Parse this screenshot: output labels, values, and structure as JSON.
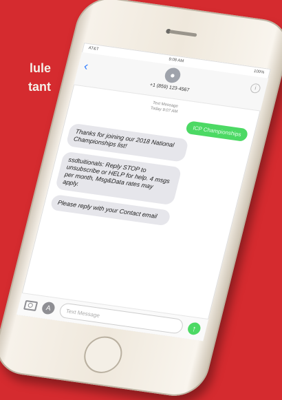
{
  "side_text": {
    "line1": "lule",
    "line2": "tant"
  },
  "status_bar": {
    "carrier": "AT&T",
    "time": "9:08 AM",
    "battery": "100%"
  },
  "conversation": {
    "contact_number": "+1 (859) 123-4567",
    "meta_line1": "Text Message",
    "meta_line2": "Today 9:07 AM",
    "outgoing_text": "ICP Championships",
    "incoming": [
      "Thanks for joining our 2018 National Championships list!",
      "ssdtuitionals: Reply STOP to unsubscribe or HELP for help. 4 msgs per month, Msg&Data rates may apply.",
      "Please reply with your Contact email"
    ]
  },
  "composer": {
    "placeholder": "Text Message",
    "send_glyph": "↑"
  },
  "colors": {
    "background": "#d52b2f",
    "bubble_out": "#4cd964",
    "bubble_in": "#e6e6eb",
    "accent": "#2f7dff"
  },
  "icons": [
    "back-chevron-icon",
    "avatar-icon",
    "info-icon",
    "camera-icon",
    "app-store-icon",
    "send-arrow-icon"
  ]
}
